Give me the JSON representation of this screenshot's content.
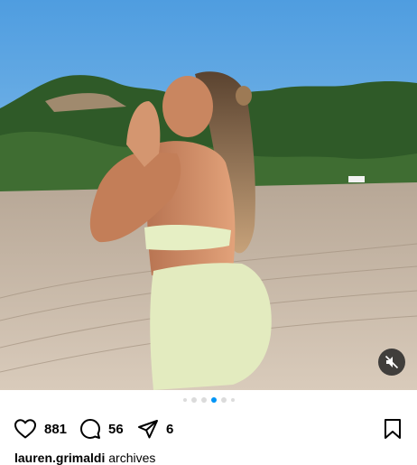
{
  "post": {
    "media": {
      "icon": "photo-of-woman-on-beach",
      "mute_icon": "speaker-muted-icon",
      "carousel_dot_count": 6,
      "carousel_active_index": 4
    },
    "actions": {
      "like_icon": "heart-icon",
      "like_count": "881",
      "comment_icon": "comment-icon",
      "comment_count": "56",
      "share_icon": "send-icon",
      "share_count": "6",
      "save_icon": "bookmark-icon"
    },
    "caption": {
      "username": "lauren.grimaldi",
      "text": "archives"
    },
    "colors": {
      "accent": "#0095f6",
      "inactive_dot": "#dbdbdb",
      "text": "#000000"
    }
  }
}
